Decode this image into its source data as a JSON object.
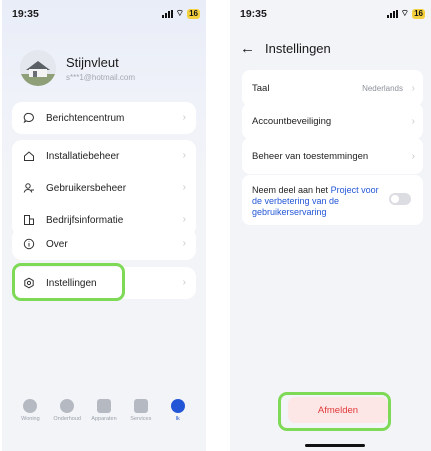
{
  "left": {
    "status": {
      "time": "19:35",
      "battery": "16"
    },
    "profile": {
      "name": "Stijnvleut",
      "email": "s***1@hotmail.com"
    },
    "menu": [
      {
        "label": "Berichtencentrum",
        "icon": "message-icon"
      },
      {
        "label": "Installatiebeheer",
        "icon": "house-icon"
      },
      {
        "label": "Gebruikersbeheer",
        "icon": "users-icon"
      },
      {
        "label": "Bedrijfsinformatie",
        "icon": "building-icon"
      },
      {
        "label": "Over",
        "icon": "info-icon"
      },
      {
        "label": "Instellingen",
        "icon": "settings-icon"
      }
    ],
    "tabs": [
      {
        "label": "Woning",
        "icon": "home-icon"
      },
      {
        "label": "Onderhoud",
        "icon": "maintenance-icon"
      },
      {
        "label": "Apparaten",
        "icon": "devices-icon"
      },
      {
        "label": "Services",
        "icon": "services-icon"
      },
      {
        "label": "Ik",
        "icon": "profile-icon"
      }
    ]
  },
  "right": {
    "status": {
      "time": "19:35",
      "battery": "16"
    },
    "title": "Instellingen",
    "rows": [
      {
        "label": "Taal",
        "value": "Nederlands"
      },
      {
        "label": "Accountbeveiliging"
      },
      {
        "label": "Beheer van toestemmingen"
      }
    ],
    "consent": {
      "prefix": "Neem deel aan het ",
      "link": "Project voor de verbetering van de gebruikerservaring"
    },
    "logout": "Afmelden"
  },
  "colors": {
    "accent": "#2356d6",
    "highlight": "#7ed957",
    "danger": "#e03a3a"
  }
}
